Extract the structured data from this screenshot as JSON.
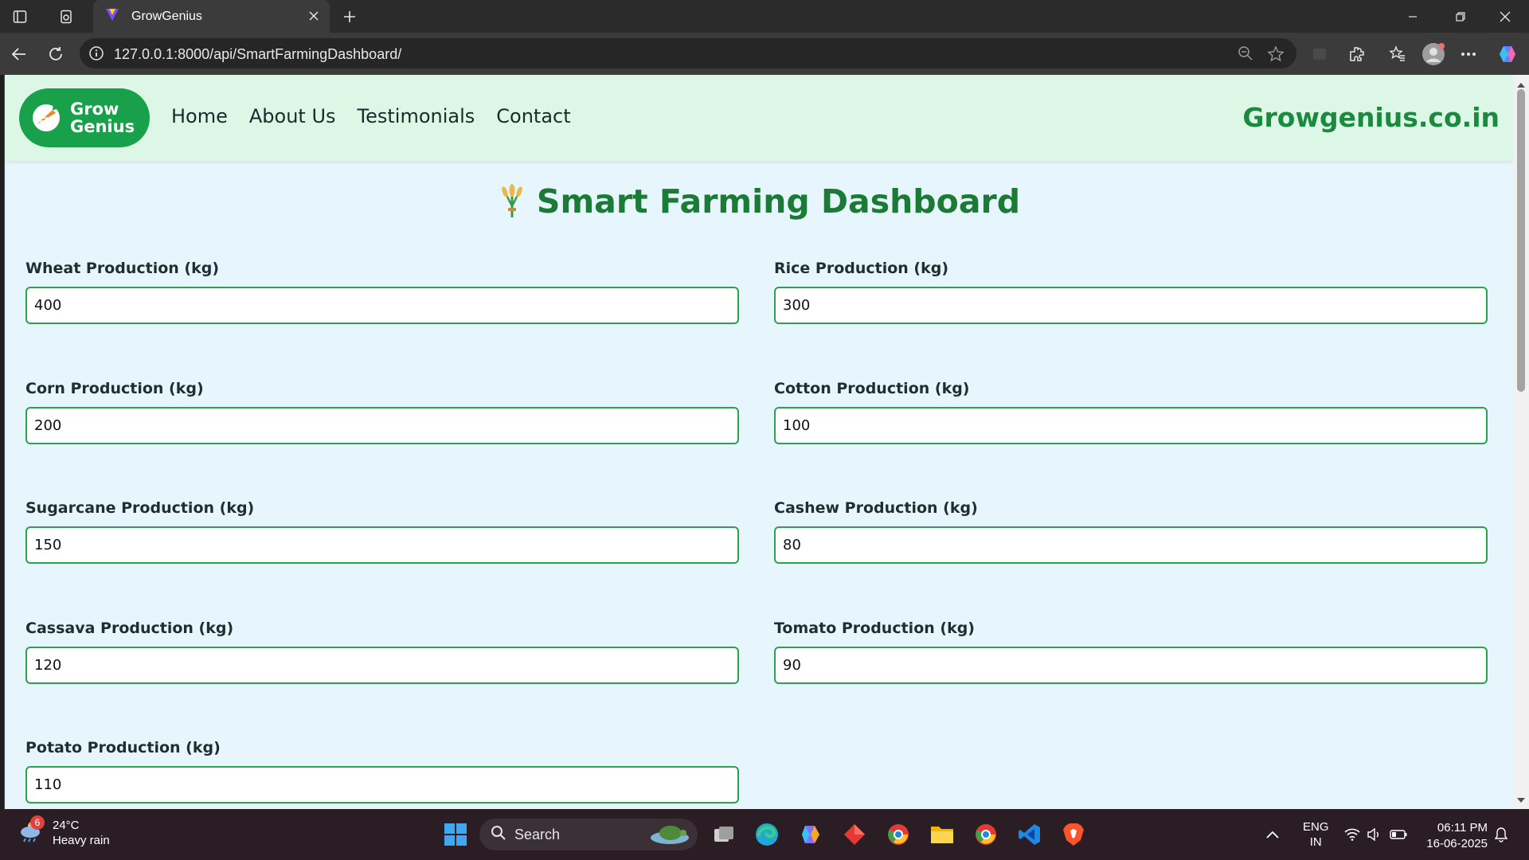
{
  "browser": {
    "tab_title": "GrowGenius",
    "url": "127.0.0.1:8000/api/SmartFarmingDashboard/"
  },
  "site": {
    "logo": {
      "line1": "Grow",
      "line2": "Genius"
    },
    "menu": [
      "Home",
      "About Us",
      "Testimonials",
      "Contact"
    ],
    "domain": "Growgenius.co.in"
  },
  "page": {
    "title": "Smart Farming Dashboard",
    "fields": [
      {
        "label": "Wheat Production (kg)",
        "value": "400"
      },
      {
        "label": "Rice Production (kg)",
        "value": "300"
      },
      {
        "label": "Corn Production (kg)",
        "value": "200"
      },
      {
        "label": "Cotton Production (kg)",
        "value": "100"
      },
      {
        "label": "Sugarcane Production (kg)",
        "value": "150"
      },
      {
        "label": "Cashew Production (kg)",
        "value": "80"
      },
      {
        "label": "Cassava Production (kg)",
        "value": "120"
      },
      {
        "label": "Tomato Production (kg)",
        "value": "90"
      },
      {
        "label": "Potato Production (kg)",
        "value": "110"
      }
    ]
  },
  "taskbar": {
    "weather": {
      "temp": "24°C",
      "condition": "Heavy rain",
      "badge": "6"
    },
    "search_label": "Search",
    "lang": {
      "line1": "ENG",
      "line2": "IN"
    },
    "time": "06:11 PM",
    "date": "16-06-2025"
  },
  "colors": {
    "brand_green": "#19a04a",
    "title_green": "#1b7a36",
    "header_bg": "#ddf7e6",
    "page_bg": "#e6f6fc",
    "input_border": "#2ca24e"
  }
}
